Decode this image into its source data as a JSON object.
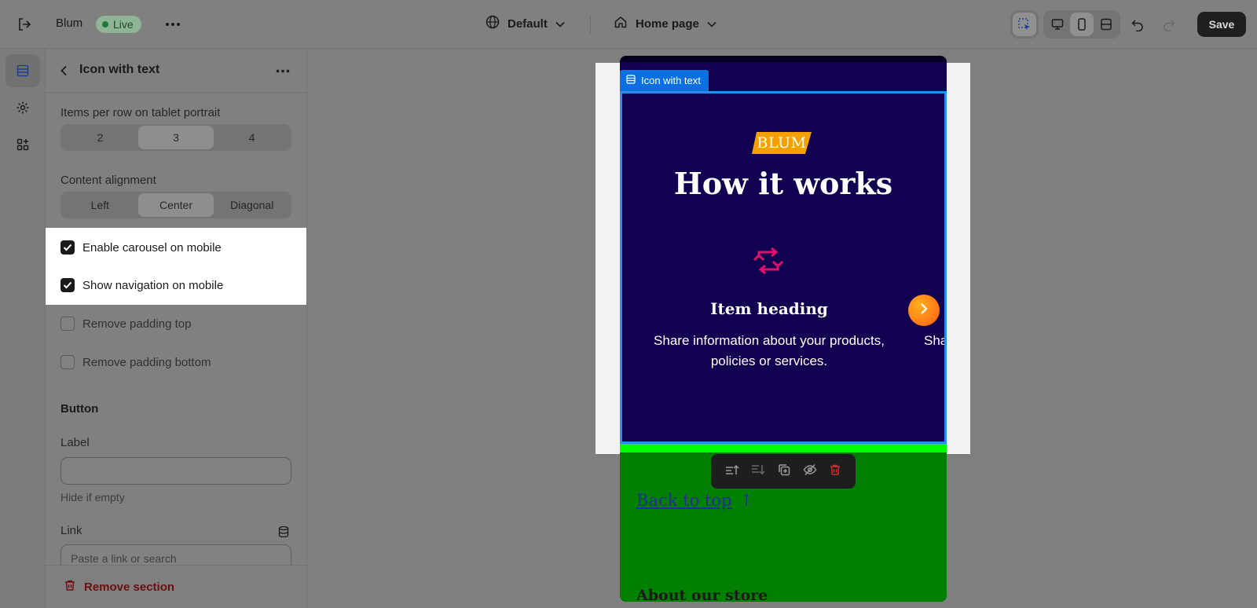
{
  "topbar": {
    "store_name": "Blum",
    "status_badge": "Live",
    "theme_selector": "Default",
    "page_selector": "Home page",
    "save_label": "Save"
  },
  "panel": {
    "title": "Icon with text",
    "items_per_row": {
      "label": "Items per row on tablet portrait",
      "options": [
        "2",
        "3",
        "4"
      ],
      "selected": "3"
    },
    "content_alignment": {
      "label": "Content alignment",
      "options": [
        "Left",
        "Center",
        "Diagonal"
      ],
      "selected": "Center"
    },
    "checkboxes": [
      {
        "label": "Enable carousel on mobile",
        "checked": true
      },
      {
        "label": "Show navigation on mobile",
        "checked": true
      },
      {
        "label": "Remove padding top",
        "checked": false
      },
      {
        "label": "Remove padding bottom",
        "checked": false
      }
    ],
    "button_section": {
      "heading": "Button",
      "label_field": {
        "label": "Label",
        "value": "",
        "help": "Hide if empty"
      },
      "link_field": {
        "label": "Link",
        "placeholder": "Paste a link or search"
      }
    },
    "remove_section_label": "Remove section"
  },
  "preview": {
    "selection_tag": "Icon with text",
    "logo_text": "BLUM",
    "heading": "How it works",
    "item_heading": "Item heading",
    "item_text": "Share information about your products, policies or services.",
    "next_item_text_partial": "Sha",
    "back_to_top": "Back to top",
    "back_to_top_arrow": "↑",
    "about_partial": "About our store"
  },
  "colors": {
    "overlay_gray": "#808080",
    "section_bg": "#120050",
    "selection_blue": "#2b8cf5",
    "logo_orange": "#f5a000",
    "icon_pink": "#e0106a",
    "footer_green": "#008000",
    "danger": "#6e0f0f"
  },
  "icons": [
    "exit-icon",
    "more-icon",
    "globe-icon",
    "chevron-down-icon",
    "home-icon",
    "inspector-icon",
    "desktop-icon",
    "mobile-icon",
    "fullwidth-icon",
    "undo-icon",
    "redo-icon",
    "sections-icon",
    "gear-icon",
    "apps-icon",
    "back-icon",
    "database-icon",
    "trash-icon",
    "swap-icon",
    "chevron-right-icon",
    "move-up-icon",
    "move-down-icon",
    "duplicate-icon",
    "hide-icon"
  ]
}
